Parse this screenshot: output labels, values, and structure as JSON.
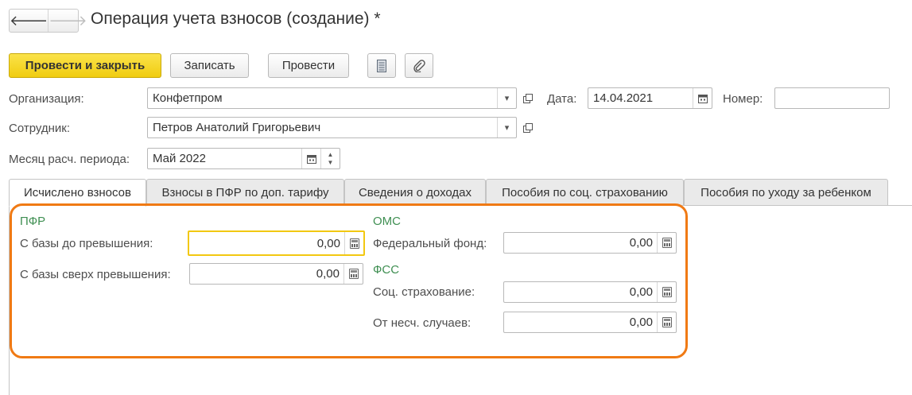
{
  "window": {
    "title": "Операция учета взносов (создание) *"
  },
  "nav": {
    "back": "🡐",
    "forward": "🡒"
  },
  "toolbar": {
    "post_close": "Провести и закрыть",
    "save": "Записать",
    "post": "Провести"
  },
  "form": {
    "organization": {
      "label": "Организация:",
      "value": "Конфетпром"
    },
    "date": {
      "label": "Дата:",
      "value": "14.04.2021"
    },
    "number": {
      "label": "Номер:",
      "value": ""
    },
    "employee": {
      "label": "Сотрудник:",
      "value": "Петров Анатолий Григорьевич"
    },
    "month": {
      "label": "Месяц расч. периода:",
      "value": "Май 2022"
    }
  },
  "tabs": [
    {
      "label": "Исчислено взносов",
      "active": true
    },
    {
      "label": "Взносы в ПФР по доп. тарифу",
      "active": false
    },
    {
      "label": "Сведения о доходах",
      "active": false
    },
    {
      "label": "Пособия по соц. страхованию",
      "active": false
    },
    {
      "label": "Пособия по уходу за ребенком",
      "active": false
    }
  ],
  "pfr": {
    "title": "ПФР",
    "below_limit": {
      "label": "С базы до превышения:",
      "value": "0,00"
    },
    "above_limit": {
      "label": "С базы сверх превышения:",
      "value": "0,00"
    }
  },
  "oms": {
    "title": "ОМС",
    "federal": {
      "label": "Федеральный фонд:",
      "value": "0,00"
    }
  },
  "fss": {
    "title": "ФСС",
    "social": {
      "label": "Соц. страхование:",
      "value": "0,00"
    },
    "accidents": {
      "label": "От несч. случаев:",
      "value": "0,00"
    }
  },
  "colors": {
    "primary_button": "#f5d41f",
    "section_title": "#3f8f52",
    "highlight_frame": "#f07a14",
    "focused_field": "#f2c811"
  },
  "icons": [
    "back-arrow-icon",
    "forward-arrow-icon",
    "report-icon",
    "attachment-icon",
    "dropdown-icon",
    "open-icon",
    "calendar-icon",
    "spin-icon",
    "calculator-icon"
  ]
}
